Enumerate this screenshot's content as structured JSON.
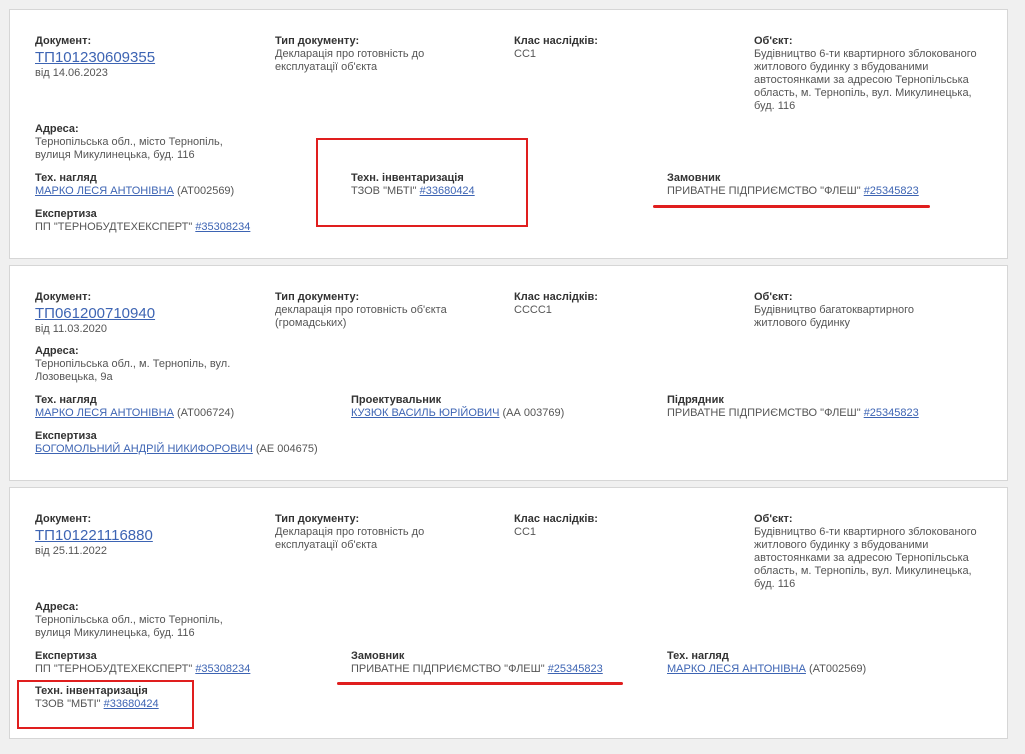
{
  "cards": [
    {
      "document": {
        "label": "Документ:",
        "number": "ТП101230609355",
        "date": "від 14.06.2023"
      },
      "doc_type": {
        "label": "Тип документу:",
        "value": "Декларація про готовність до експлуатації об'єкта"
      },
      "class": {
        "label": "Клас наслідків:",
        "value": "СС1"
      },
      "object": {
        "label": "Об'єкт:",
        "value": "Будівництво 6-ти квартирного зблокованого житлового будинку з вбудованими автостоянками за адресою Тернопільська область, м. Тернопіль, вул. Микулинецька, буд. 116"
      },
      "address": {
        "label": "Адреса:",
        "value": "Тернопільська обл., місто Тернопіль, вулиця Микулинецька, буд. 116"
      },
      "tech_supervision": {
        "label": "Тех. нагляд",
        "name": "МАРКО ЛЕСЯ АНТОНІВНА",
        "cert": "(АТ002569)"
      },
      "tech_inventory": {
        "label": "Техн. інвентаризація",
        "name": "ТЗОВ \"МБТІ\"",
        "code": "#33680424"
      },
      "customer": {
        "label": "Замовник",
        "name": "ПРИВАТНЕ ПІДПРИЄМСТВО \"ФЛЕШ\"",
        "code": "#25345823"
      },
      "expertise": {
        "label": "Експертиза",
        "name": "ПП \"ТЕРНОБУДТЕХЕКСПЕРТ\"",
        "code": "#35308234"
      }
    },
    {
      "document": {
        "label": "Документ:",
        "number": "ТП061200710940",
        "date": "від 11.03.2020"
      },
      "doc_type": {
        "label": "Тип документу:",
        "value": "декларація про готовність об'єкта (громадських)"
      },
      "class": {
        "label": "Клас наслідків:",
        "value": "СССС1"
      },
      "object": {
        "label": "Об'єкт:",
        "value": "Будівництво багатоквартирного житлового будинку"
      },
      "address": {
        "label": "Адреса:",
        "value": "Тернопільська обл., м. Тернопіль, вул. Лозовецька, 9а"
      },
      "tech_supervision": {
        "label": "Тех. нагляд",
        "name": "МАРКО ЛЕСЯ АНТОНІВНА",
        "cert": "(АТ006724)"
      },
      "designer": {
        "label": "Проектувальник",
        "name": "КУЗЮК ВАСИЛЬ ЮРІЙОВИЧ",
        "cert": "(АА 003769)"
      },
      "contractor": {
        "label": "Підрядник",
        "name": "ПРИВАТНЕ ПІДПРИЄМСТВО \"ФЛЕШ\"",
        "code": "#25345823"
      },
      "expertise": {
        "label": "Експертиза",
        "name": "БОГОМОЛЬНИЙ АНДРІЙ НИКИФОРОВИЧ",
        "cert": "(АЕ 004675)"
      }
    },
    {
      "document": {
        "label": "Документ:",
        "number": "ТП101221116880",
        "date": "від 25.11.2022"
      },
      "doc_type": {
        "label": "Тип документу:",
        "value": "Декларація про готовність до експлуатації об'єкта"
      },
      "class": {
        "label": "Клас наслідків:",
        "value": "СС1"
      },
      "object": {
        "label": "Об'єкт:",
        "value": "Будівництво 6-ти квартирного зблокованого житлового будинку з вбудованими автостоянками за адресою Тернопільська область, м. Тернопіль, вул. Микулинецька, буд. 116"
      },
      "address": {
        "label": "Адреса:",
        "value": "Тернопільська обл., місто Тернопіль, вулиця Микулинецька, буд. 116"
      },
      "expertise": {
        "label": "Експертиза",
        "name": "ПП \"ТЕРНОБУДТЕХЕКСПЕРТ\"",
        "code": "#35308234"
      },
      "customer": {
        "label": "Замовник",
        "name": "ПРИВАТНЕ ПІДПРИЄМСТВО \"ФЛЕШ\"",
        "code": "#25345823"
      },
      "tech_supervision": {
        "label": "Тех. нагляд",
        "name": "МАРКО ЛЕСЯ АНТОНІВНА",
        "cert": "(АТ002569)"
      },
      "tech_inventory": {
        "label": "Техн. інвентаризація",
        "name": "ТЗОВ \"МБТІ\"",
        "code": "#33680424"
      }
    }
  ],
  "colors": {
    "link": "#3d64b3",
    "highlight": "#e01e1e",
    "card_border": "#d6d6d6",
    "page_bg": "#f0f0f0"
  }
}
